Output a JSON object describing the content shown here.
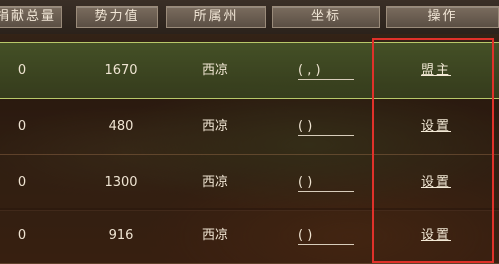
{
  "header": {
    "columns": [
      "捐献总量",
      "势力值",
      "所属州",
      "坐标",
      "操作"
    ]
  },
  "rows": [
    {
      "donation": "0",
      "power": "1670",
      "state": "西凉",
      "coord": "(  ,   )",
      "action": "盟主"
    },
    {
      "donation": "0",
      "power": "480",
      "state": "西凉",
      "coord": "(       )",
      "action": "设置"
    },
    {
      "donation": "0",
      "power": "1300",
      "state": "西凉",
      "coord": "(       )",
      "action": "设置"
    },
    {
      "donation": "0",
      "power": "916",
      "state": "西凉",
      "coord": "(       )",
      "action": "设置"
    }
  ],
  "colors": {
    "highlight": "#e0312a",
    "active_row_border": "#b8c86a"
  }
}
